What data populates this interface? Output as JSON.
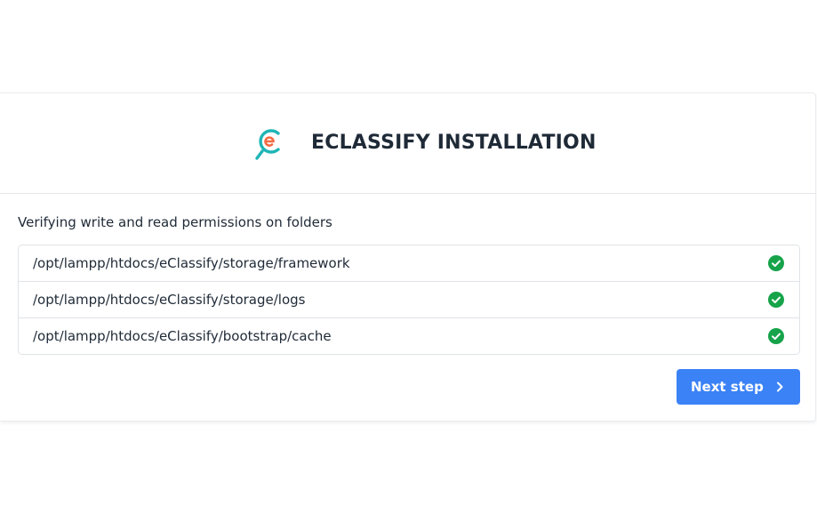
{
  "header": {
    "logo_icon": "eclassify-logo-icon",
    "title": "ECLASSIFY INSTALLATION"
  },
  "permissions": {
    "heading": "Verifying write and read permissions on folders",
    "folders": [
      {
        "path": "/opt/lampp/htdocs/eClassify/storage/framework",
        "status_icon": "check-circle-icon",
        "status": "ok"
      },
      {
        "path": "/opt/lampp/htdocs/eClassify/storage/logs",
        "status_icon": "check-circle-icon",
        "status": "ok"
      },
      {
        "path": "/opt/lampp/htdocs/eClassify/bootstrap/cache",
        "status_icon": "check-circle-icon",
        "status": "ok"
      }
    ]
  },
  "actions": {
    "next_label": "Next step",
    "next_icon": "chevron-right-icon"
  },
  "colors": {
    "accent": "#3b82f6",
    "success": "#16a34a",
    "logo_teal": "#1fb5b5",
    "logo_orange": "#f46b45",
    "text": "#1f2a37"
  }
}
